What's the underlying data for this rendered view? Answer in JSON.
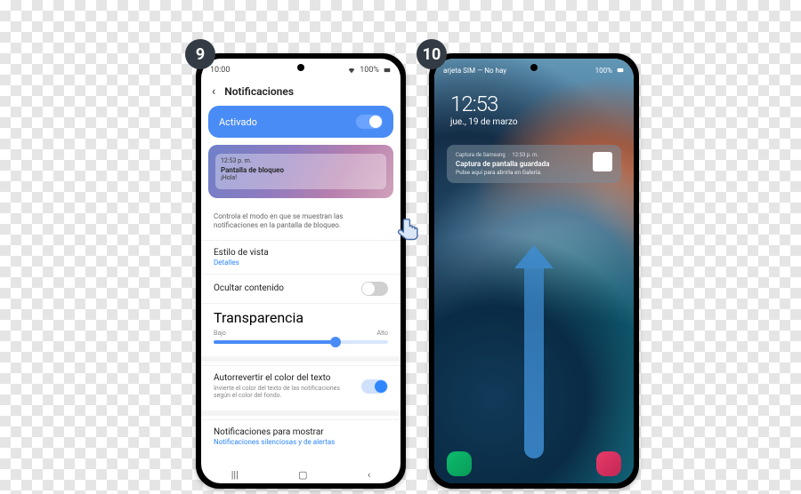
{
  "steps": {
    "s9": "9",
    "s10": "10"
  },
  "screen1": {
    "status": {
      "time": "10:00",
      "battery": "100%"
    },
    "title": "Notificaciones",
    "activado": "Activado",
    "preview": {
      "time": "12:53 p. m.",
      "title": "Pantalla de bloqueo",
      "body": "¡Hola!"
    },
    "description": "Controla el modo en que se muestran las notificaciones en la pantalla de bloqueo.",
    "viewStyle": {
      "label": "Estilo de vista",
      "value": "Detalles"
    },
    "hideContent": "Ocultar contenido",
    "transparency": {
      "label": "Transparencia",
      "low": "Bajo",
      "high": "Alto",
      "value": 0.7
    },
    "autoColor": {
      "label": "Autorrevertir el color del texto",
      "sub": "Invierte el color del texto de las notificaciones según el color del fondo."
    },
    "toShow": {
      "label": "Notificaciones para mostrar",
      "value": "Notificaciones silenciosas y de alertas"
    }
  },
  "screen2": {
    "status": {
      "sim": "arjeta SIM — No hay",
      "battery": "100%"
    },
    "clock": {
      "time": "12:53",
      "date": "jue., 19 de marzo"
    },
    "notif": {
      "source": "Captura de Samsung",
      "ts": "12:53 p. m.",
      "title": "Captura de pantalla guardada",
      "sub": "Pulse aquí para abrirla en Galería."
    }
  }
}
